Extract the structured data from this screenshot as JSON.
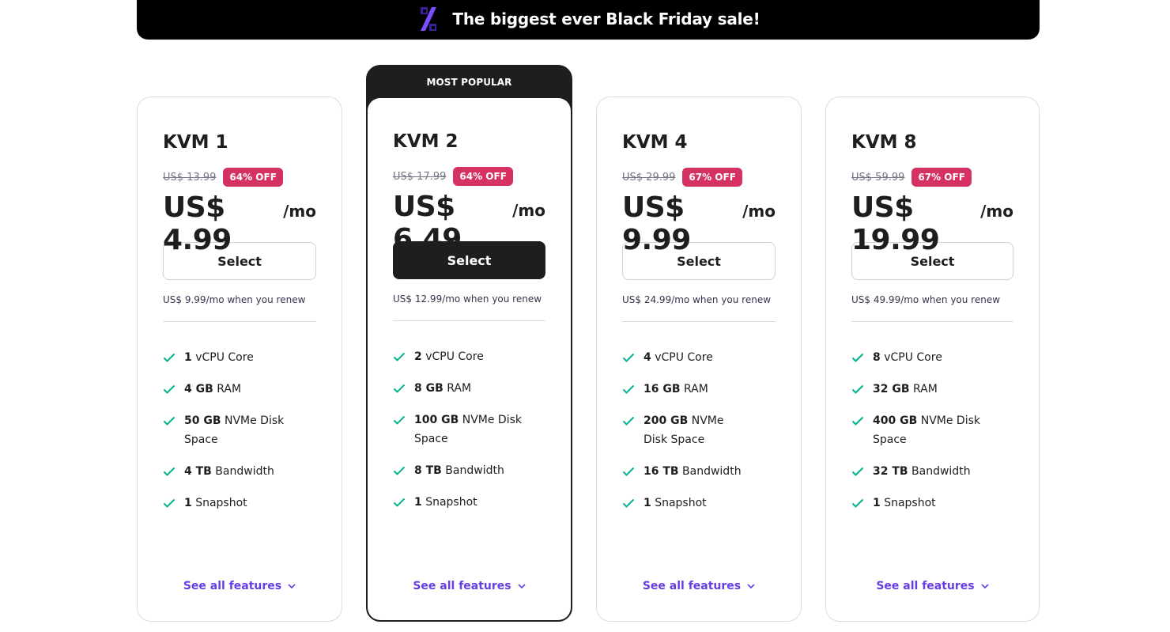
{
  "banner": {
    "icon": "percent-icon",
    "text": "The biggest ever Black Friday sale!"
  },
  "colors": {
    "accent": "#673de6",
    "discount_badge": "#d63163",
    "check": "#00b090",
    "dark": "#1d1e20"
  },
  "plans": [
    {
      "name": "KVM 1",
      "old_price": "US$ 13.99",
      "discount": "64% OFF",
      "price": "US$ 4.99",
      "period": "/mo",
      "button": "Select",
      "renew": "US$ 9.99/mo when you renew",
      "features": [
        {
          "bold": "1",
          "text": " vCPU Core"
        },
        {
          "bold": "4 GB",
          "text": " RAM"
        },
        {
          "bold": "50 GB",
          "text": " NVMe Disk Space"
        },
        {
          "bold": "4 TB",
          "text": " Bandwidth"
        },
        {
          "bold": "1",
          "text": " Snapshot"
        }
      ],
      "see_all": "See all features"
    },
    {
      "popular_label": "MOST POPULAR",
      "name": "KVM 2",
      "old_price": "US$ 17.99",
      "discount": "64% OFF",
      "price": "US$ 6.49",
      "period": "/mo",
      "button": "Select",
      "renew": "US$ 12.99/mo when you renew",
      "features": [
        {
          "bold": "2",
          "text": " vCPU Core"
        },
        {
          "bold": "8 GB",
          "text": " RAM"
        },
        {
          "bold": "100 GB",
          "text": " NVMe Disk Space"
        },
        {
          "bold": "8 TB",
          "text": " Bandwidth"
        },
        {
          "bold": "1",
          "text": " Snapshot"
        }
      ],
      "see_all": "See all features"
    },
    {
      "name": "KVM 4",
      "old_price": "US$ 29.99",
      "discount": "67% OFF",
      "price": "US$ 9.99",
      "period": "/mo",
      "button": "Select",
      "renew": "US$ 24.99/mo when you renew",
      "features": [
        {
          "bold": "4",
          "text": " vCPU Core"
        },
        {
          "bold": "16 GB",
          "text": " RAM"
        },
        {
          "bold": "200 GB",
          "text": " NVMe Disk Space"
        },
        {
          "bold": "16 TB",
          "text": " Bandwidth"
        },
        {
          "bold": "1",
          "text": " Snapshot"
        }
      ],
      "see_all": "See all features"
    },
    {
      "name": "KVM 8",
      "old_price": "US$ 59.99",
      "discount": "67% OFF",
      "price": "US$ 19.99",
      "period": "/mo",
      "button": "Select",
      "renew": "US$ 49.99/mo when you renew",
      "features": [
        {
          "bold": "8",
          "text": " vCPU Core"
        },
        {
          "bold": "32 GB",
          "text": " RAM"
        },
        {
          "bold": "400 GB",
          "text": " NVMe Disk Space"
        },
        {
          "bold": "32 TB",
          "text": " Bandwidth"
        },
        {
          "bold": "1",
          "text": " Snapshot"
        }
      ],
      "see_all": "See all features"
    }
  ]
}
